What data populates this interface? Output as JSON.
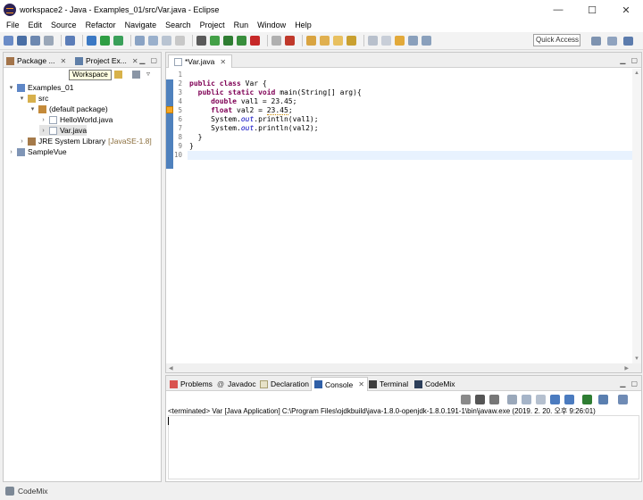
{
  "window": {
    "title": "workspace2 - Java - Examples_01/src/Var.java - Eclipse",
    "minimize": "—",
    "maximize": "☐",
    "close": "✕"
  },
  "menu": [
    "File",
    "Edit",
    "Source",
    "Refactor",
    "Navigate",
    "Search",
    "Project",
    "Run",
    "Window",
    "Help"
  ],
  "toolbar": {
    "quick_access_label": "Quick Access"
  },
  "left_view": {
    "tabs": [
      {
        "label": "Package ...",
        "close": "✕"
      },
      {
        "label": "Project Ex...",
        "close": "✕"
      }
    ],
    "tooltip": "Workspace",
    "tree": [
      {
        "label": "Examples_01",
        "decor": ""
      },
      {
        "label": "src",
        "decor": ""
      },
      {
        "label": "(default package)",
        "decor": ""
      },
      {
        "label": "HelloWorld.java",
        "decor": ""
      },
      {
        "label": "Var.java",
        "decor": ""
      },
      {
        "label": "JRE System Library",
        "decor": "[JavaSE-1.8]"
      },
      {
        "label": "SampleVue",
        "decor": ""
      }
    ]
  },
  "editor": {
    "tab_label": "*Var.java",
    "tab_close": "✕",
    "line_numbers": [
      "1",
      "2",
      "3",
      "4",
      "5",
      "6",
      "7",
      "8",
      "9",
      "10"
    ],
    "lines": {
      "l2_kw1": "public",
      "l2_kw2": "class",
      "l2_rest": " Var {",
      "l3_kw1": "public",
      "l3_kw2": "static",
      "l3_kw3": "void",
      "l3_rest": " main(String[] arg){",
      "l4_kw": "double",
      "l4_rest": " val1 = 23.45;",
      "l5_kw": "float",
      "l5_rest_a": " val2 = ",
      "l5_err": "23.45",
      "l5_rest_b": ";",
      "l6_a": "System.",
      "l6_fld": "out",
      "l6_b": ".println(val1);",
      "l7_a": "System.",
      "l7_fld": "out",
      "l7_b": ".println(val2);",
      "l8": "}",
      "l9": "}"
    }
  },
  "console": {
    "tabs": [
      {
        "label": "Problems"
      },
      {
        "label": "Javadoc"
      },
      {
        "label": "Declaration"
      },
      {
        "label": "Console",
        "close": "✕"
      },
      {
        "label": "Terminal"
      },
      {
        "label": "CodeMix"
      }
    ],
    "status": "<terminated> Var [Java Application] C:\\Program Files\\ojdkbuild\\java-1.8.0-openjdk-1.8.0.191-1\\bin\\javaw.exe (2019. 2. 20. 오후 9:26:01)"
  },
  "statusbar": {
    "label": "CodeMix"
  }
}
